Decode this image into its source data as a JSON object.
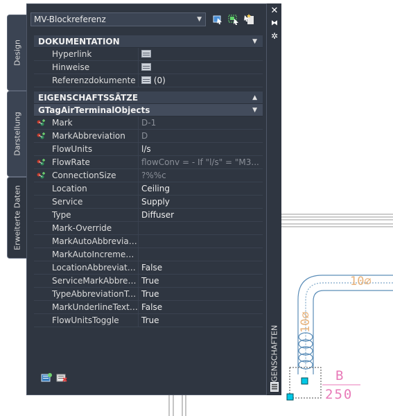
{
  "palette": {
    "title": "EIGENSCHAFTEN",
    "tabs": [
      {
        "label": "Design"
      },
      {
        "label": "Darstellung"
      },
      {
        "label": "Erweiterte Daten"
      }
    ],
    "object_selector": "MV-Blockreferenz"
  },
  "sections": {
    "documentation": {
      "title": "DOKUMENTATION",
      "rows": [
        {
          "name": "Hyperlink",
          "value": ""
        },
        {
          "name": "Hinweise",
          "value": ""
        },
        {
          "name": "Referenzdokumente",
          "value": "(0)"
        }
      ]
    },
    "property_sets": {
      "title": "EIGENSCHAFTSSÄTZE",
      "subsection": "GTagAirTerminalObjects",
      "rows": [
        {
          "name": "Mark",
          "value": "D-1",
          "linked": true,
          "dim": true
        },
        {
          "name": "MarkAbbreviation",
          "value": "D",
          "linked": true,
          "dim": true
        },
        {
          "name": "FlowUnits",
          "value": "l/s",
          "linked": false,
          "dim": false
        },
        {
          "name": "FlowRate",
          "value": "flowConv = - If \"l/s\" = \"M3...",
          "linked": true,
          "dim": true
        },
        {
          "name": "ConnectionSize",
          "value": "?%%c",
          "linked": true,
          "dim": true
        },
        {
          "name": "Location",
          "value": "Ceiling",
          "linked": false,
          "dim": false
        },
        {
          "name": "Service",
          "value": "Supply",
          "linked": false,
          "dim": false
        },
        {
          "name": "Type",
          "value": "Diffuser",
          "linked": false,
          "dim": false
        },
        {
          "name": "Mark-Override",
          "value": "",
          "linked": false,
          "dim": false
        },
        {
          "name": "MarkAutoAbbreviatio...",
          "value": "",
          "linked": false,
          "dim": false
        },
        {
          "name": "MarkAutoIncrementN...",
          "value": "",
          "linked": false,
          "dim": false
        },
        {
          "name": "LocationAbbreviation...",
          "value": "False",
          "linked": false,
          "dim": false
        },
        {
          "name": "ServiceMarkAbbreviat...",
          "value": "True",
          "linked": false,
          "dim": false
        },
        {
          "name": "TypeAbbreviationTog...",
          "value": "True",
          "linked": false,
          "dim": false
        },
        {
          "name": "MarkUnderlineTextTo...",
          "value": "False",
          "linked": false,
          "dim": false
        },
        {
          "name": "FlowUnitsToggle",
          "value": "True",
          "linked": false,
          "dim": false
        }
      ]
    }
  },
  "drawing": {
    "duct_label": "10⌀",
    "duct_label_vertical": "10⌀",
    "tag_letter": "B",
    "tag_number": "250",
    "colors": {
      "duct": "#5b8db8",
      "label": "#e8b27a",
      "tag": "#e87ab8",
      "grip": "#00c8e6"
    }
  }
}
